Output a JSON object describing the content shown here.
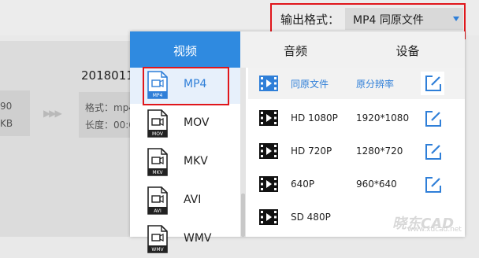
{
  "header": {
    "output_format_label": "输出格式：",
    "output_format_value": "MP4  同原文件"
  },
  "background": {
    "file_title": "2018011",
    "left_line1": "90",
    "left_line2": "KB",
    "format_label": "格式：mp4",
    "duration_label": "长度：00:0"
  },
  "dropdown": {
    "tabs": [
      {
        "label": "视频",
        "active": true
      },
      {
        "label": "音频",
        "active": false
      },
      {
        "label": "设备",
        "active": false
      }
    ],
    "formats": [
      {
        "name": "MP4",
        "badge": "MP4",
        "selected": true
      },
      {
        "name": "MOV",
        "badge": "MOV",
        "selected": false
      },
      {
        "name": "MKV",
        "badge": "MKV",
        "selected": false
      },
      {
        "name": "AVI",
        "badge": "AVI",
        "selected": false
      },
      {
        "name": "WMV",
        "badge": "WMV",
        "selected": false
      }
    ],
    "quality_header": {
      "name": "同原文件",
      "resolution": "原分辨率"
    },
    "qualities": [
      {
        "name": "HD 1080P",
        "resolution": "1920*1080"
      },
      {
        "name": "HD 720P",
        "resolution": "1280*720"
      },
      {
        "name": "640P",
        "resolution": "960*640"
      },
      {
        "name": "SD 480P",
        "resolution": ""
      }
    ]
  },
  "watermark": {
    "text": "晓东CAD",
    "url": "www.xdcad.net"
  },
  "colors": {
    "accent": "#2f8ae0",
    "highlight": "#e0161b"
  }
}
